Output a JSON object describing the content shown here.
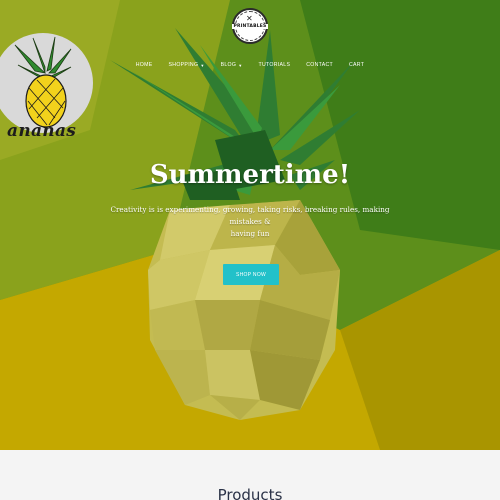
{
  "brand": {
    "logo_text": "PRINTABLES",
    "badge_word": "ananas"
  },
  "nav": {
    "items": [
      {
        "label": "HOME",
        "dropdown": false
      },
      {
        "label": "SHOPPING",
        "dropdown": true
      },
      {
        "label": "BLOG",
        "dropdown": true
      },
      {
        "label": "TUTORIALS",
        "dropdown": false
      },
      {
        "label": "CONTACT",
        "dropdown": false
      },
      {
        "label": "CART",
        "dropdown": false
      }
    ]
  },
  "hero": {
    "title": "Summertime!",
    "subtitle_line1": "Creativity is is experimenting, growing, taking risks, breaking rules, making mistakes &",
    "subtitle_line2": "having fun",
    "button_label": "SHOP NOW"
  },
  "products": {
    "heading": "Products"
  },
  "colors": {
    "accent_button": "#22c1c9",
    "hero_green": "#4f8a14",
    "hero_yellow": "#c9b300",
    "pineapple_body": "#c8c05a",
    "leaf": "#2f7d32"
  },
  "icons": [
    "printables-logo-icon",
    "pineapple-icon",
    "caret-down-icon"
  ]
}
